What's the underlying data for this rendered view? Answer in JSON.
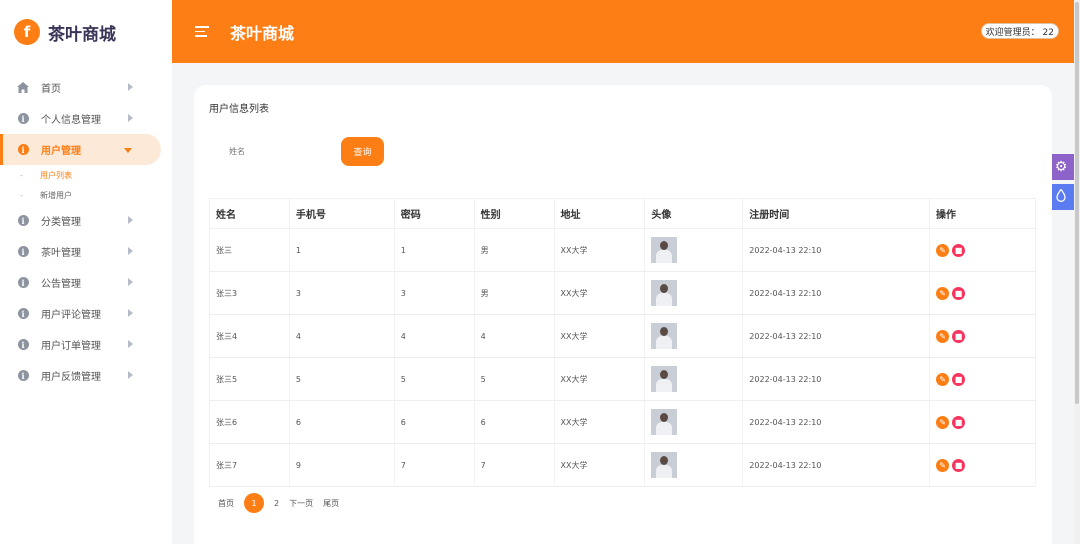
{
  "brand": {
    "logo_letter": "f",
    "name": "茶叶商城"
  },
  "header": {
    "title": "茶叶商城",
    "welcome": "欢迎管理员：  22"
  },
  "sidebar": {
    "items": [
      {
        "label": "首页",
        "icon": "home-icon"
      },
      {
        "label": "个人信息管理",
        "icon": "info-icon"
      },
      {
        "label": "用户管理",
        "icon": "info-icon",
        "expanded": true
      },
      {
        "label": "分类管理",
        "icon": "info-icon"
      },
      {
        "label": "茶叶管理",
        "icon": "info-icon"
      },
      {
        "label": "公告管理",
        "icon": "info-icon"
      },
      {
        "label": "用户评论管理",
        "icon": "info-icon"
      },
      {
        "label": "用户订单管理",
        "icon": "info-icon"
      },
      {
        "label": "用户反馈管理",
        "icon": "info-icon"
      }
    ],
    "subitems": [
      {
        "label": "用户列表",
        "current": true
      },
      {
        "label": "新增用户",
        "current": false
      }
    ]
  },
  "card": {
    "title": "用户信息列表",
    "search_placeholder": "姓名",
    "search_button": "查询"
  },
  "table": {
    "headers": [
      "姓名",
      "手机号",
      "密码",
      "性别",
      "地址",
      "头像",
      "注册时间",
      "操作"
    ],
    "rows": [
      {
        "name": "张三",
        "phone": "1",
        "password": "1",
        "gender": "男",
        "address": "XX大学",
        "time": "2022-04-13 22:10"
      },
      {
        "name": "张三3",
        "phone": "3",
        "password": "3",
        "gender": "男",
        "address": "XX大学",
        "time": "2022-04-13 22:10"
      },
      {
        "name": "张三4",
        "phone": "4",
        "password": "4",
        "gender": "4",
        "address": "XX大学",
        "time": "2022-04-13 22:10"
      },
      {
        "name": "张三5",
        "phone": "5",
        "password": "5",
        "gender": "5",
        "address": "XX大学",
        "time": "2022-04-13 22:10"
      },
      {
        "name": "张三6",
        "phone": "6",
        "password": "6",
        "gender": "6",
        "address": "XX大学",
        "time": "2022-04-13 22:10"
      },
      {
        "name": "张三7",
        "phone": "9",
        "password": "7",
        "gender": "7",
        "address": "XX大学",
        "time": "2022-04-13 22:10"
      }
    ]
  },
  "pager": {
    "first": "首页",
    "current": "1",
    "next_page_num": "2",
    "next": "下一页",
    "last": "尾页"
  },
  "colors": {
    "accent": "#fd7e14",
    "danger": "#f7345e",
    "settings": "#8e63c9",
    "theme": "#5b7cf0"
  }
}
